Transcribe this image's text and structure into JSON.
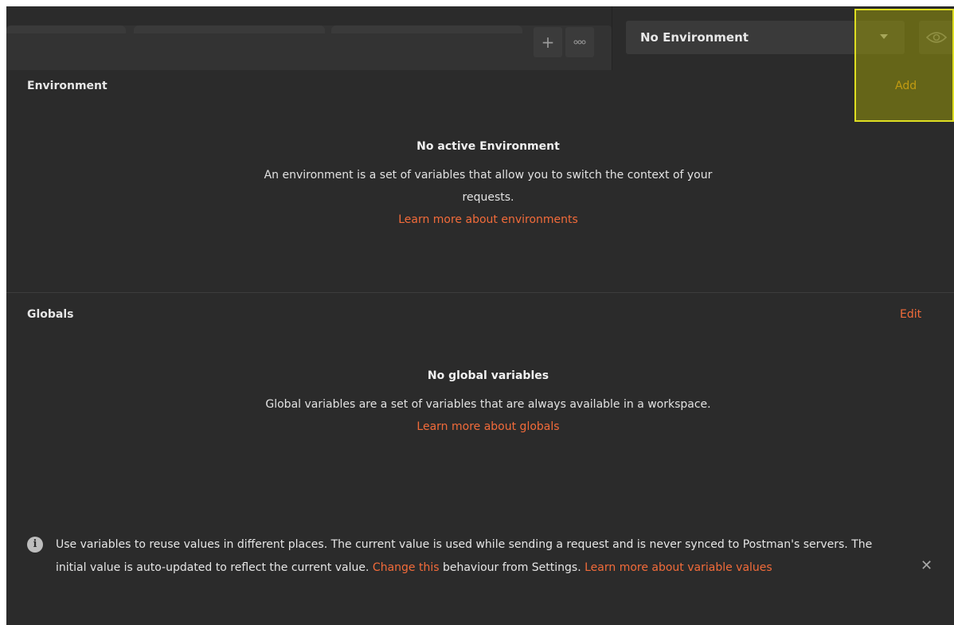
{
  "header": {
    "new_tab_icon": "plus-icon",
    "more_icon": "ellipsis-icon",
    "environment_select": {
      "selected": "No Environment",
      "icon": "chevron-down-icon"
    },
    "eye_icon": "eye-icon"
  },
  "environment": {
    "title": "Environment",
    "action": "Add",
    "empty_title": "No active Environment",
    "empty_desc": "An environment is a set of variables that allow you to switch the context of your requests.",
    "learn_more": "Learn more about environments"
  },
  "globals": {
    "title": "Globals",
    "action": "Edit",
    "empty_title": "No global variables",
    "empty_desc": "Global variables are a set of variables that are always available in a workspace.",
    "learn_more": "Learn more about globals"
  },
  "info_banner": {
    "icon": "info-icon",
    "text_1": "Use variables to reuse values in different places. The current value is used while sending a request and is never synced to Postman's servers. The initial value is auto-updated to reflect the current value. ",
    "link_change": "Change this",
    "text_2": " behaviour from Settings. ",
    "link_learn": "Learn more about variable values",
    "close_icon": "close-icon"
  },
  "colors": {
    "background": "#2b2b2b",
    "accent_link": "#f26b3a",
    "add_link": "#f7a21c",
    "highlight": "#dede22"
  }
}
